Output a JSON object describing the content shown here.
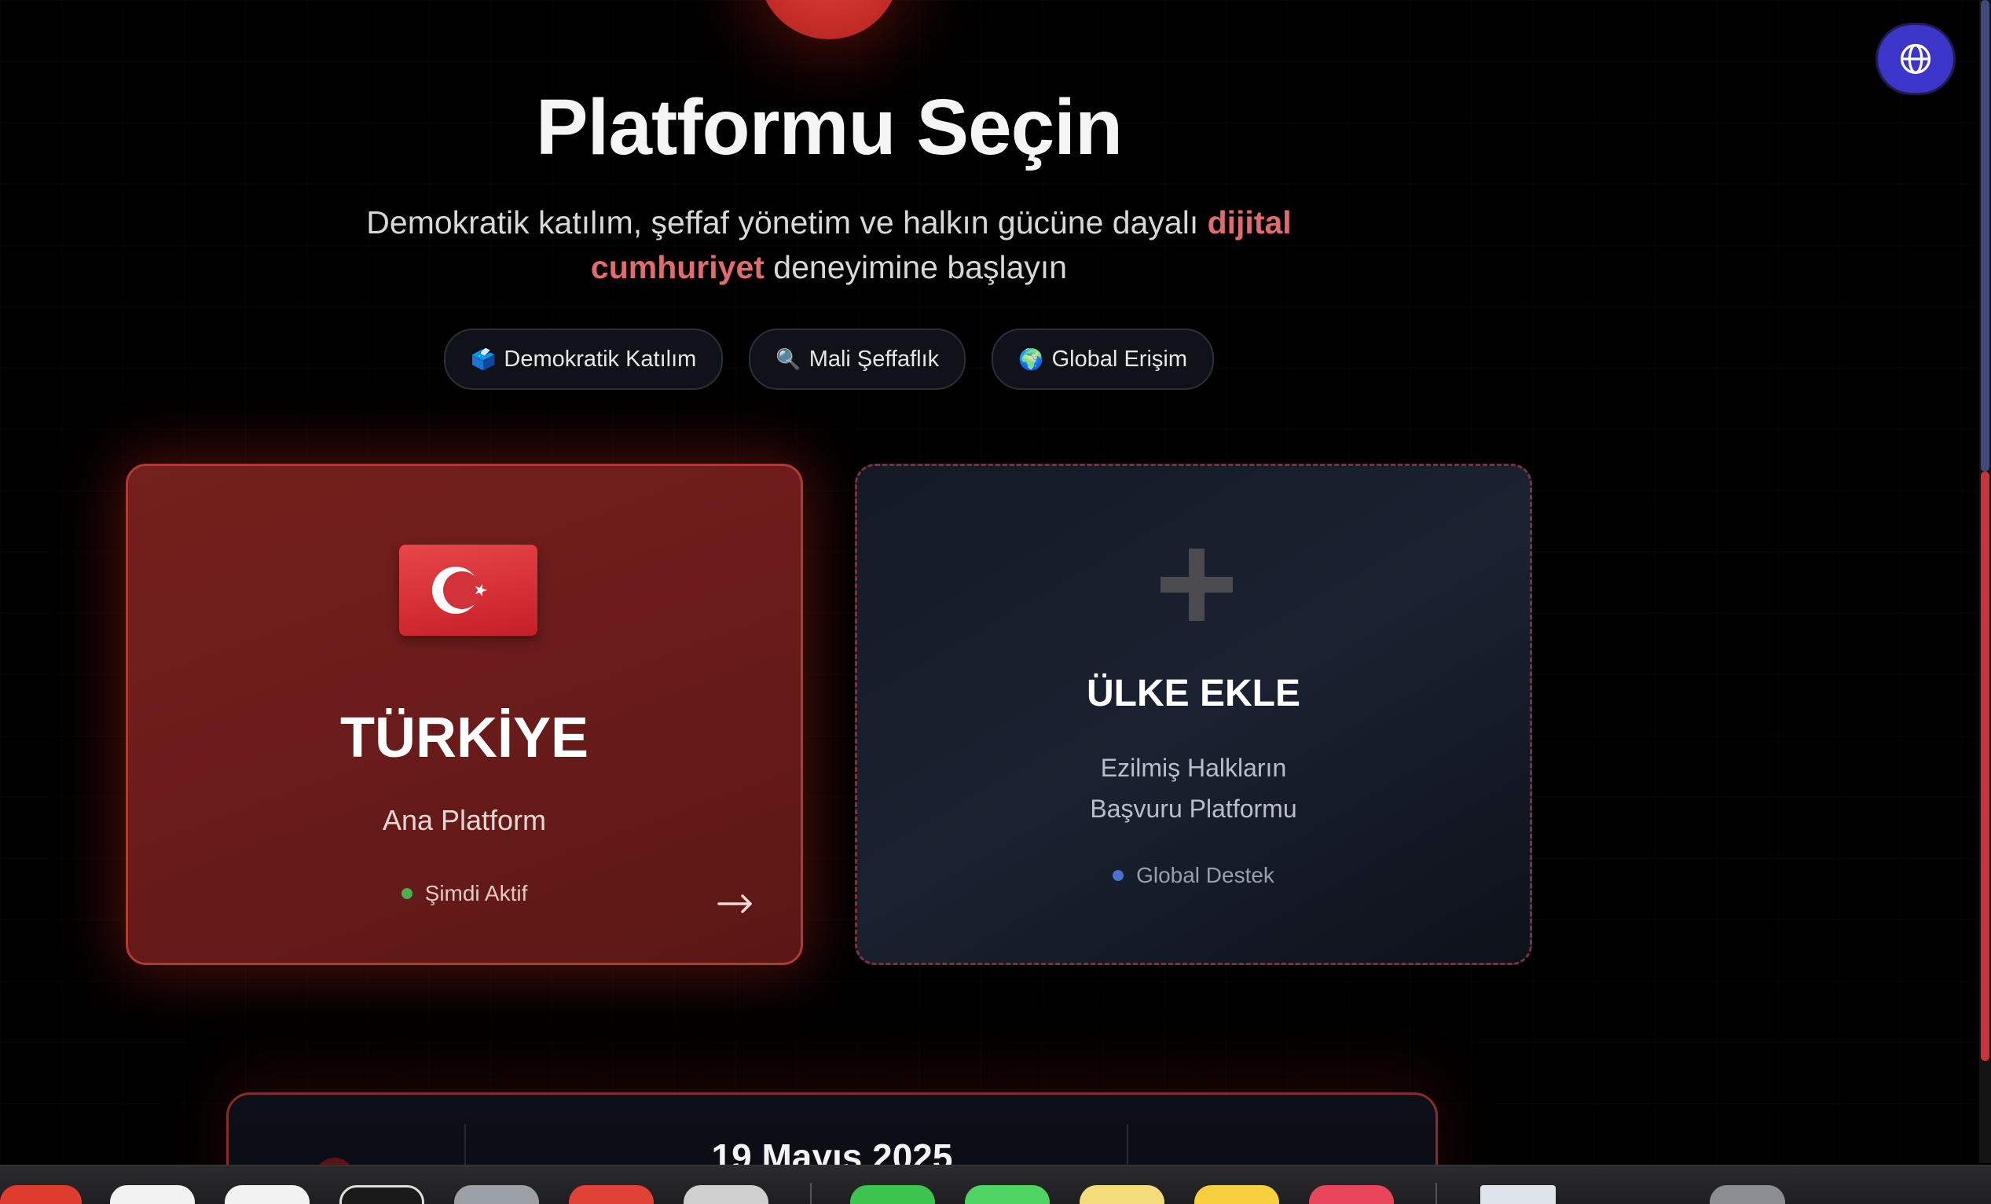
{
  "header": {
    "title": "Platformu Seçin",
    "subtitle_part1": "Demokratik katılım, şeffaf yönetim ve halkın gücüne dayalı ",
    "subtitle_highlight": "dijital cumhuriyet",
    "subtitle_part2": " deneyimine başlayın",
    "language_button_icon": "globe-icon"
  },
  "pills": [
    {
      "emoji": "🗳️",
      "label": "Demokratik Katılım"
    },
    {
      "emoji": "🔍",
      "label": "Mali Şeffaflık"
    },
    {
      "emoji": "🌍",
      "label": "Global Erişim"
    }
  ],
  "cards": {
    "turkey": {
      "icon": "turkey-flag-icon",
      "title": "TÜRKİYE",
      "subtitle": "Ana Platform",
      "status": "Şimdi Aktif",
      "status_color": "#4caf50",
      "arrow": "→"
    },
    "add_country": {
      "icon": "plus-icon",
      "title": "ÜLKE EKLE",
      "subtitle_line1": "Ezilmiş Halkların",
      "subtitle_line2": "Başvuru Platformu",
      "status": "Global Destek",
      "status_color": "#4d6fcf"
    }
  },
  "bottom_panel": {
    "date": "19 Mayıs 2025"
  },
  "colors": {
    "accent_red": "#b23a33",
    "highlight": "#e26b6b",
    "language_button": "#3b35c9",
    "background": "#000000"
  }
}
